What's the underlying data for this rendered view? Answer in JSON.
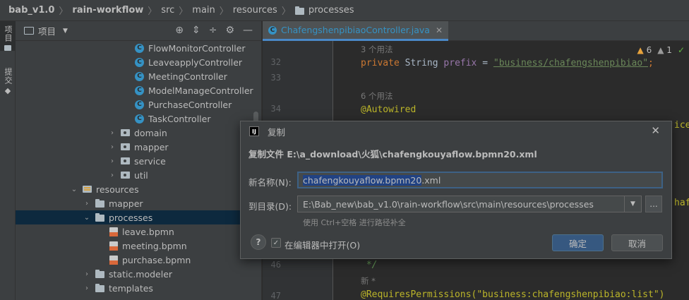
{
  "breadcrumb": {
    "items": [
      "bab_v1.0",
      "rain-workflow",
      "src",
      "main",
      "resources",
      "processes"
    ]
  },
  "toolstrip": {
    "project_label": "项目",
    "commit_label": "提交"
  },
  "project_panel": {
    "title": "项目",
    "tree": [
      {
        "label": "FlowMonitorController",
        "kind": "class"
      },
      {
        "label": "LeaveapplyController",
        "kind": "class"
      },
      {
        "label": "MeetingController",
        "kind": "class"
      },
      {
        "label": "ModelManageController",
        "kind": "class"
      },
      {
        "label": "PurchaseController",
        "kind": "class"
      },
      {
        "label": "TaskController",
        "kind": "class"
      },
      {
        "label": "domain",
        "kind": "package"
      },
      {
        "label": "mapper",
        "kind": "package"
      },
      {
        "label": "service",
        "kind": "package"
      },
      {
        "label": "util",
        "kind": "package"
      },
      {
        "label": "resources",
        "kind": "resources"
      },
      {
        "label": "mapper",
        "kind": "folder"
      },
      {
        "label": "processes",
        "kind": "folder"
      },
      {
        "label": "leave.bpmn",
        "kind": "bpmn"
      },
      {
        "label": "meeting.bpmn",
        "kind": "bpmn"
      },
      {
        "label": "purchase.bpmn",
        "kind": "bpmn"
      },
      {
        "label": "static.modeler",
        "kind": "folder"
      },
      {
        "label": "templates",
        "kind": "folder"
      }
    ]
  },
  "editor": {
    "tab_label": "ChafengshenpibiaoController.java",
    "warnings": {
      "warn_count": "6",
      "weak_count": "1"
    },
    "lines": {
      "hint1": "3 个用法",
      "num32": "32",
      "code32_kw": "private ",
      "code32_type": "String ",
      "code32_field": "prefix",
      "code32_eq": " = ",
      "code32_str": "\"business/chafengshenpibiao\"",
      "code32_end": ";",
      "num33": "33",
      "hint2": "6 个用法",
      "num34": "34",
      "code34": "@Autowired",
      "num46": "46",
      "code46": " */",
      "hint3": "新 *",
      "num47": "47",
      "code47": "@RequiresPermissions(\"business:chafengshenpibiao:list\")"
    }
  },
  "dialog": {
    "title": "复制",
    "heading": "复制文件 E:\\a_download\\火狐\\chafengkouyaflow.bpmn20.xml",
    "name_label": "新名称(N):",
    "name_value_selected": "chafengkouyaflow.bpmn20",
    "name_value_rest": ".xml",
    "dir_label": "到目录(D):",
    "dir_value": "E:\\Bab_new\\bab_v1.0\\rain-workflow\\src\\main\\resources\\processes",
    "browse_label": "...",
    "hint": "使用 Ctrl+空格 进行路径补全",
    "help_label": "?",
    "open_in_editor_label": "在编辑器中打开(O)",
    "open_in_editor_checked": true,
    "ok_label": "确定",
    "cancel_label": "取消"
  }
}
